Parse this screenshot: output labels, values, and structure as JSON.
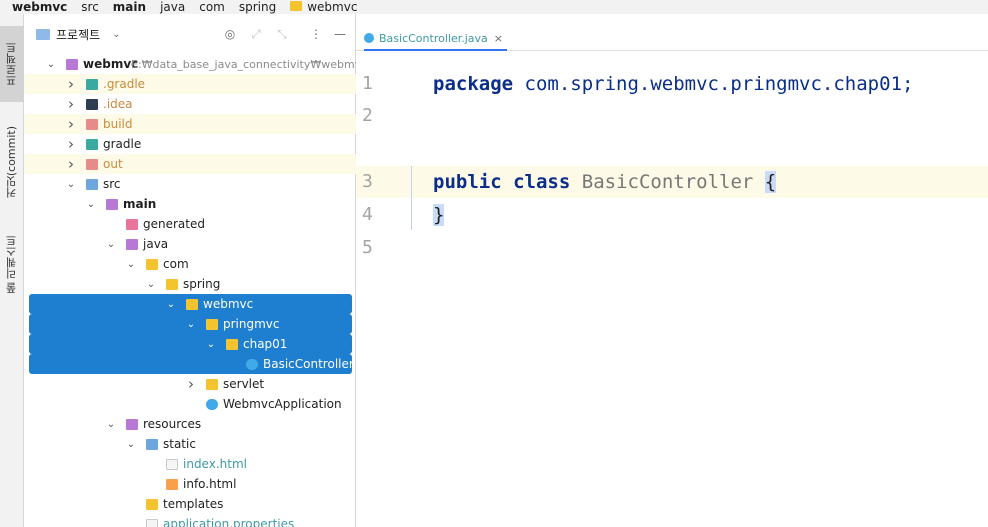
{
  "breadcrumb": [
    {
      "label": "webmvc",
      "bold": true,
      "folder": false
    },
    {
      "label": "src",
      "bold": false,
      "folder": false
    },
    {
      "label": "main",
      "bold": true,
      "folder": false
    },
    {
      "label": "java",
      "bold": false,
      "folder": false
    },
    {
      "label": "com",
      "bold": false,
      "folder": false
    },
    {
      "label": "spring",
      "bold": false,
      "folder": false
    },
    {
      "label": "webmvc",
      "bold": false,
      "folder": true
    }
  ],
  "left_strip": {
    "project_tab": "프로젝트",
    "commit_tab": "커밋(commit)",
    "pull_requests_tab": "풀 리퀘스트"
  },
  "project_panel": {
    "title": "프로젝트",
    "root_path": "E:₩data_base_java_connectivity₩webmvc",
    "tree": [
      {
        "label": "webmvc",
        "depth": 0,
        "arrow": "down",
        "icon": "folder-p",
        "bold": true,
        "extra": "E:₩data_base_java_connectivity₩webmvc"
      },
      {
        "label": ".gradle",
        "depth": 1,
        "arrow": "right",
        "icon": "folder-teal",
        "style": "orange",
        "hl": true
      },
      {
        "label": ".idea",
        "depth": 1,
        "arrow": "right",
        "icon": "folder-dark",
        "style": "orange"
      },
      {
        "label": "build",
        "depth": 1,
        "arrow": "right",
        "icon": "folder-red",
        "style": "orange",
        "hl": true
      },
      {
        "label": "gradle",
        "depth": 1,
        "arrow": "right",
        "icon": "folder-teal"
      },
      {
        "label": "out",
        "depth": 1,
        "arrow": "right",
        "icon": "folder-red",
        "style": "orange",
        "hl": true
      },
      {
        "label": "src",
        "depth": 1,
        "arrow": "down",
        "icon": "folder-b"
      },
      {
        "label": "main",
        "depth": 2,
        "arrow": "down",
        "icon": "folder-p",
        "bold": true
      },
      {
        "label": "generated",
        "depth": 3,
        "arrow": "",
        "icon": "folder-pink"
      },
      {
        "label": "java",
        "depth": 3,
        "arrow": "down",
        "icon": "folder-p"
      },
      {
        "label": "com",
        "depth": 4,
        "arrow": "down",
        "icon": "folder-y"
      },
      {
        "label": "spring",
        "depth": 5,
        "arrow": "down",
        "icon": "folder-y"
      },
      {
        "label": "webmvc",
        "depth": 6,
        "arrow": "down",
        "icon": "folder-y",
        "sel": true
      },
      {
        "label": "pringmvc",
        "depth": 7,
        "arrow": "down",
        "icon": "folder-y",
        "sel": true
      },
      {
        "label": "chap01",
        "depth": 8,
        "arrow": "down",
        "icon": "folder-y",
        "sel": true
      },
      {
        "label": "BasicController",
        "depth": 9,
        "arrow": "",
        "icon": "java-c",
        "sel": true
      },
      {
        "label": "servlet",
        "depth": 7,
        "arrow": "right",
        "icon": "folder-y"
      },
      {
        "label": "WebmvcApplication",
        "depth": 7,
        "arrow": "",
        "icon": "java-c"
      },
      {
        "label": "resources",
        "depth": 3,
        "arrow": "down",
        "icon": "folder-p"
      },
      {
        "label": "static",
        "depth": 4,
        "arrow": "down",
        "icon": "folder-b"
      },
      {
        "label": "index.html",
        "depth": 5,
        "arrow": "",
        "icon": "html-f",
        "style": "teal"
      },
      {
        "label": "info.html",
        "depth": 5,
        "arrow": "",
        "icon": "html-o"
      },
      {
        "label": "templates",
        "depth": 4,
        "arrow": "",
        "icon": "folder-y"
      },
      {
        "label": "application.properties",
        "depth": 4,
        "arrow": "",
        "icon": "html-f",
        "style": "teal"
      }
    ]
  },
  "editor": {
    "tab_label": "BasicController.java",
    "close_glyph": "×",
    "line_numbers": [
      "1",
      "2",
      "3",
      "4",
      "5"
    ],
    "code": {
      "l1_kw": "package",
      "l1_rest": " com.spring.webmvc.pringmvc.chap01;",
      "l3_kw1": "public",
      "l3_kw2": "class",
      "l3_cls": "BasicController",
      "l3_brace": "{",
      "l4_brace": "}"
    }
  },
  "colors": {
    "selection": "#1e7fd0",
    "keyword": "#0a2e8a",
    "current_line": "#fdfbe7",
    "tab_underline": "#3574f0"
  }
}
